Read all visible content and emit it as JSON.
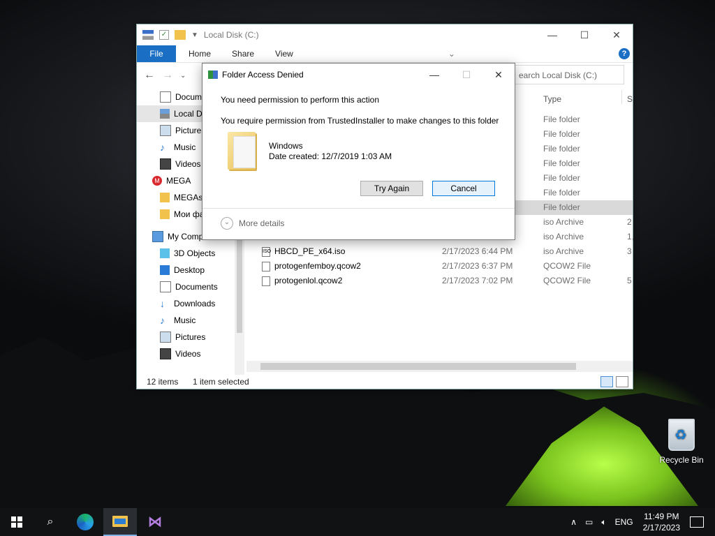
{
  "desktop": {
    "recycle_bin_label": "Recycle Bin"
  },
  "explorer": {
    "title": "Local Disk (C:)",
    "ribbon": {
      "file": "File",
      "tabs": [
        "Home",
        "Share",
        "View"
      ]
    },
    "search_placeholder": "earch Local Disk (C:)",
    "columns": {
      "type": "Type",
      "size_partial": "S"
    },
    "nav_items": [
      {
        "label": "Documents",
        "icon": "documents-icon"
      },
      {
        "label": "Local Disk (C:)",
        "icon": "local-disk-icon"
      },
      {
        "label": "Pictures",
        "icon": "pictures-icon"
      },
      {
        "label": "Music",
        "icon": "music-icon"
      },
      {
        "label": "Videos",
        "icon": "videos-icon"
      },
      {
        "label": "MEGA",
        "icon": "mega-icon"
      },
      {
        "label": "MEGAsync",
        "icon": "mega-folder-icon"
      },
      {
        "label": "Мои фа",
        "icon": "folder-icon"
      },
      {
        "label": "My Computer",
        "icon": "computer-icon"
      },
      {
        "label": "3D Objects",
        "icon": "3d-objects-icon"
      },
      {
        "label": "Desktop",
        "icon": "desktop-icon"
      },
      {
        "label": "Documents",
        "icon": "documents-icon"
      },
      {
        "label": "Downloads",
        "icon": "downloads-icon"
      },
      {
        "label": "Music",
        "icon": "music-icon"
      },
      {
        "label": "Pictures",
        "icon": "pictures-icon"
      },
      {
        "label": "Videos",
        "icon": "videos-icon"
      }
    ],
    "rows": [
      {
        "name": "",
        "date": "",
        "type": "File folder",
        "size": ""
      },
      {
        "name": "",
        "date": "",
        "type": "File folder",
        "size": ""
      },
      {
        "name": "",
        "date": "",
        "type": "File folder",
        "size": ""
      },
      {
        "name": "",
        "date": "",
        "type": "File folder",
        "size": ""
      },
      {
        "name": "",
        "date": "",
        "type": "File folder",
        "size": ""
      },
      {
        "name": "",
        "date": "",
        "type": "File folder",
        "size": ""
      },
      {
        "name": "",
        "date": "",
        "type": "File folder",
        "size": ""
      },
      {
        "name": "",
        "date": "",
        "type": "iso Archive",
        "size": "2"
      },
      {
        "name": "",
        "date": "",
        "type": "iso Archive",
        "size": "1,"
      },
      {
        "name": "HBCD_PE_x64.iso",
        "date": "2/17/2023 6:44 PM",
        "type": "iso Archive",
        "size": "3"
      },
      {
        "name": "protogenfemboy.qcow2",
        "date": "2/17/2023 6:37 PM",
        "type": "QCOW2 File",
        "size": ""
      },
      {
        "name": "protogenlol.qcow2",
        "date": "2/17/2023 7:02 PM",
        "type": "QCOW2 File",
        "size": "5"
      }
    ],
    "status": {
      "items": "12 items",
      "selected": "1 item selected"
    }
  },
  "dialog": {
    "title": "Folder Access Denied",
    "message1": "You need permission to perform this action",
    "message2": "You require permission from TrustedInstaller to make changes to this folder",
    "folder_name": "Windows",
    "folder_date": "Date created: 12/7/2019 1:03 AM",
    "try_again": "Try Again",
    "cancel": "Cancel",
    "more_details": "More details"
  },
  "taskbar": {
    "language": "ENG",
    "time": "11:49 PM",
    "date": "2/17/2023"
  }
}
